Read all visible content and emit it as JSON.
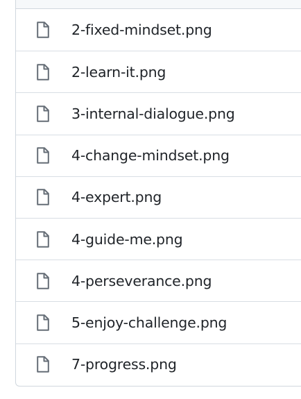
{
  "files": [
    {
      "name": "2-fixed-mindset.png",
      "icon": "file-icon"
    },
    {
      "name": "2-learn-it.png",
      "icon": "file-icon"
    },
    {
      "name": "3-internal-dialogue.png",
      "icon": "file-icon"
    },
    {
      "name": "4-change-mindset.png",
      "icon": "file-icon"
    },
    {
      "name": "4-expert.png",
      "icon": "file-icon"
    },
    {
      "name": "4-guide-me.png",
      "icon": "file-icon"
    },
    {
      "name": "4-perseverance.png",
      "icon": "file-icon"
    },
    {
      "name": "5-enjoy-challenge.png",
      "icon": "file-icon"
    },
    {
      "name": "7-progress.png",
      "icon": "file-icon"
    }
  ],
  "colors": {
    "icon": "#656d76",
    "text": "#1f2328",
    "border": "#d0d7de"
  }
}
